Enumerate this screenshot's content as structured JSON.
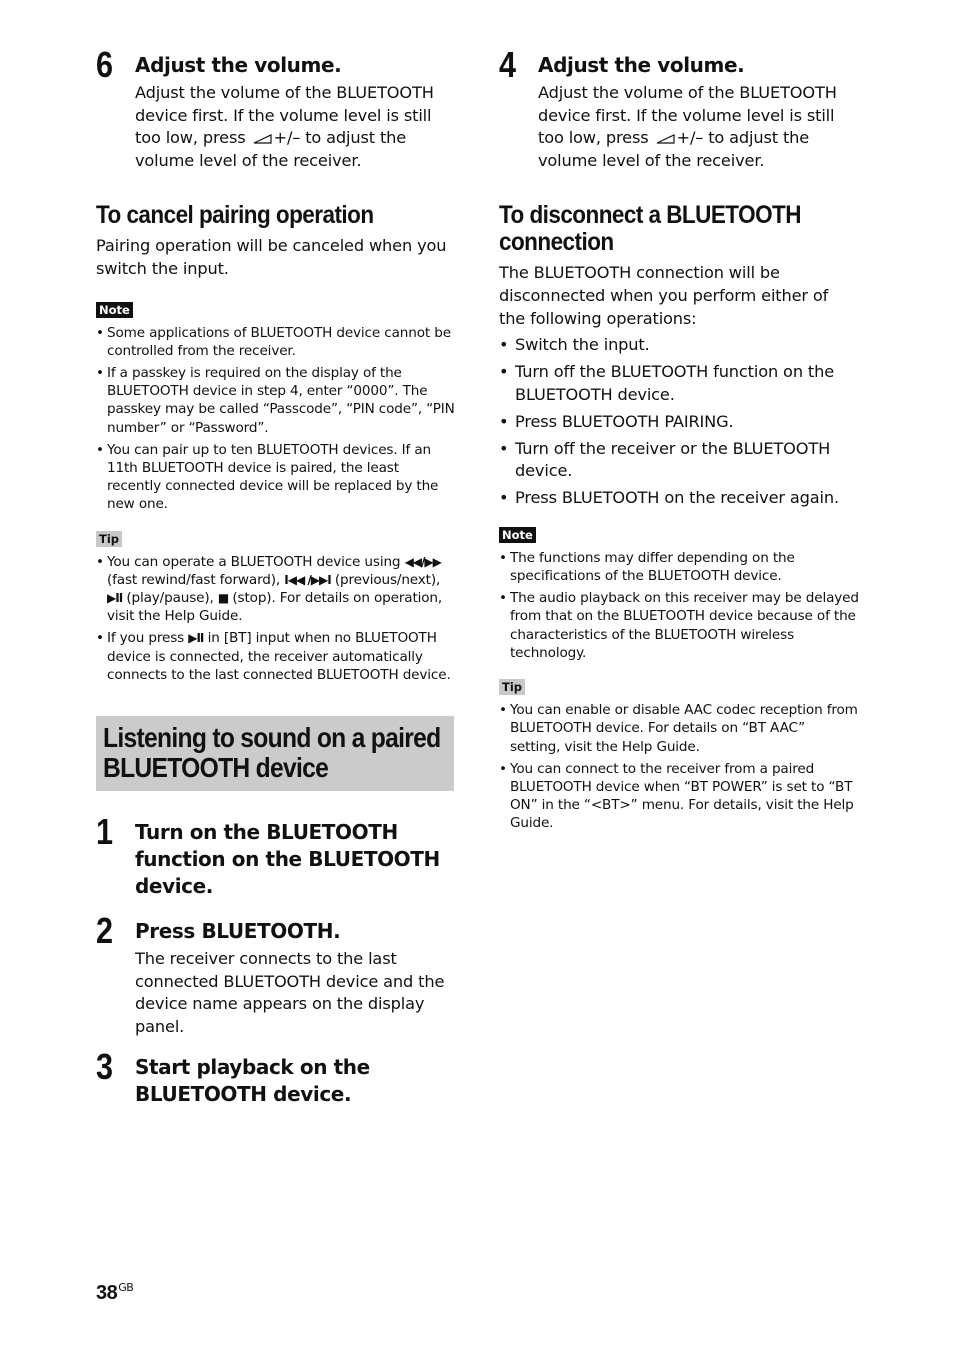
{
  "left": {
    "step6": {
      "number": "6",
      "title": "Adjust the volume.",
      "body_part1": "Adjust the volume of the BLUETOOTH device first. If the volume level is still too low, press",
      "volume_icon": "volume-icon",
      "body_part2": "+/– to adjust the volume level of the receiver."
    },
    "cancel_pairing": {
      "heading": "To cancel pairing operation",
      "body": "Pairing operation will be canceled when you switch the input."
    },
    "note": {
      "label": "Note",
      "items": [
        "Some applications of BLUETOOTH device cannot be controlled from the receiver.",
        "If a passkey is required on the display of the BLUETOOTH device in step 4, enter “0000”. The passkey may be called “Passcode”, “PIN code”, “PIN number” or “Password”.",
        "You can pair up to ten BLUETOOTH devices. If an 11th BLUETOOTH device is paired, the least recently connected device will be replaced by the new one."
      ]
    },
    "tip": {
      "label": "Tip",
      "item1": {
        "t1": "You can operate a BLUETOOTH device using",
        "rew_ff": "◀◀/▶▶",
        "t2": "(fast rewind/fast forward),",
        "prev_next": "I◀◀ /▶▶I",
        "t3": "(previous/next),",
        "play_pause": "▶II",
        "t4": "(play/pause),",
        "stop": "■",
        "t5": "(stop). For details on operation, visit the Help Guide."
      },
      "item2": {
        "t1": "If you press",
        "play_pause": "▶II",
        "t2": "in [BT] input when no BLUETOOTH device is connected, the receiver automatically connects to the last connected BLUETOOTH device."
      }
    },
    "section_banner": {
      "line1": "Listening to sound on a paired",
      "line2": "BLUETOOTH device"
    },
    "steps": [
      {
        "number": "1",
        "title": "Turn on the BLUETOOTH function on the BLUETOOTH device.",
        "body": ""
      },
      {
        "number": "2",
        "title": "Press BLUETOOTH.",
        "body": "The receiver connects to the last connected BLUETOOTH device and the device name appears on the display panel."
      },
      {
        "number": "3",
        "title": "Start playback on the BLUETOOTH device.",
        "body": ""
      }
    ]
  },
  "right": {
    "step4": {
      "number": "4",
      "title": "Adjust the volume.",
      "body_part1": "Adjust the volume of the BLUETOOTH device first. If the volume level is still too low, press",
      "volume_icon": "volume-icon",
      "body_part2": "+/– to adjust the volume level of the receiver."
    },
    "disconnect": {
      "heading_line1": "To disconnect a BLUETOOTH",
      "heading_line2": "connection",
      "body": "The BLUETOOTH connection will be disconnected when you perform either of the following operations:",
      "items": [
        "Switch the input.",
        "Turn off the BLUETOOTH function on the BLUETOOTH device.",
        "Press BLUETOOTH PAIRING.",
        "Turn off the receiver or the BLUETOOTH device.",
        "Press BLUETOOTH on the receiver again."
      ]
    },
    "note": {
      "label": "Note",
      "items": [
        "The functions may differ depending on the specifications of the BLUETOOTH device.",
        "The audio playback on this receiver may be delayed from that on the BLUETOOTH device because of the characteristics of the BLUETOOTH wireless technology."
      ]
    },
    "tip": {
      "label": "Tip",
      "items": [
        "You can enable or disable AAC codec reception from BLUETOOTH device. For details on “BT AAC” setting, visit the Help Guide.",
        "You can connect to the receiver from a paired BLUETOOTH device when “BT POWER” is set to “BT ON” in the “<BT>” menu. For details, visit the Help Guide."
      ]
    }
  },
  "footer": {
    "page_number": "38",
    "region": "GB"
  }
}
